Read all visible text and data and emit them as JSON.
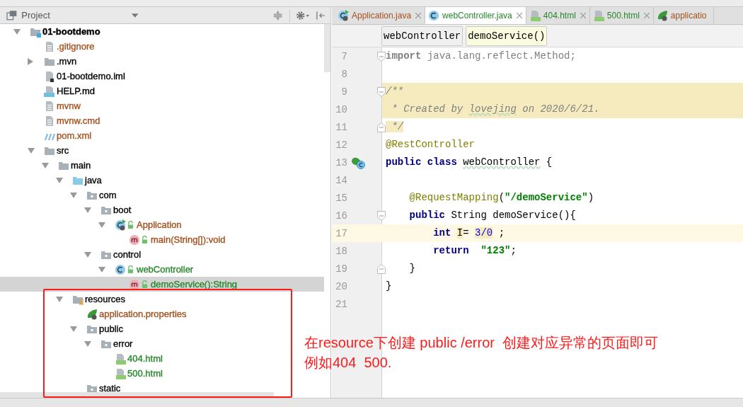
{
  "project_panel": {
    "title": "Project",
    "tree": [
      {
        "label": "01-bootdemo",
        "kind": "module",
        "color": "#000000",
        "expanded": true,
        "selected": false,
        "children": [
          {
            "label": ".gitignore",
            "kind": "file",
            "color": "#a4501e",
            "selected": false
          },
          {
            "label": ".mvn",
            "kind": "folder",
            "color": "#000000",
            "expanded": false,
            "selected": false
          },
          {
            "label": "01-bootdemo.iml",
            "kind": "iml",
            "color": "#000000",
            "selected": false
          },
          {
            "label": "HELP.md",
            "kind": "md",
            "color": "#000000",
            "selected": false
          },
          {
            "label": "mvnw",
            "kind": "file",
            "color": "#a4501e",
            "selected": false
          },
          {
            "label": "mvnw.cmd",
            "kind": "file",
            "color": "#a4501e",
            "selected": false
          },
          {
            "label": "pom.xml",
            "kind": "maven",
            "color": "#a4501e",
            "selected": false
          },
          {
            "label": "src",
            "kind": "folder",
            "color": "#000000",
            "expanded": true,
            "selected": false,
            "children": [
              {
                "label": "main",
                "kind": "folder",
                "color": "#000000",
                "expanded": true,
                "selected": false,
                "children": [
                  {
                    "label": "java",
                    "kind": "source",
                    "color": "#000000",
                    "expanded": true,
                    "selected": false,
                    "children": [
                      {
                        "label": "com",
                        "kind": "package",
                        "color": "#000000",
                        "expanded": true,
                        "selected": false,
                        "children": [
                          {
                            "label": "boot",
                            "kind": "package",
                            "color": "#000000",
                            "expanded": true,
                            "selected": false,
                            "children": [
                              {
                                "label": "Application",
                                "kind": "spring-class",
                                "color": "#a4501e",
                                "expanded": true,
                                "selected": false,
                                "children": [
                                  {
                                    "label": "main(String[]):void",
                                    "kind": "method",
                                    "color": "#a4501e",
                                    "selected": false
                                  }
                                ]
                              }
                            ]
                          },
                          {
                            "label": "control",
                            "kind": "package",
                            "color": "#000000",
                            "expanded": true,
                            "selected": false,
                            "children": [
                              {
                                "label": "webController",
                                "kind": "class",
                                "color": "#26882a",
                                "expanded": true,
                                "selected": false,
                                "children": [
                                  {
                                    "label": "demoService():String",
                                    "kind": "method",
                                    "color": "#26882a",
                                    "selected": true
                                  }
                                ]
                              }
                            ]
                          }
                        ]
                      }
                    ]
                  },
                  {
                    "label": "resources",
                    "kind": "resources",
                    "color": "#000000",
                    "expanded": true,
                    "selected": false,
                    "children": [
                      {
                        "label": "application.properties",
                        "kind": "spring-config",
                        "color": "#a4501e",
                        "selected": false
                      },
                      {
                        "label": "public",
                        "kind": "package",
                        "color": "#000000",
                        "expanded": true,
                        "selected": false,
                        "children": [
                          {
                            "label": "error",
                            "kind": "package",
                            "color": "#000000",
                            "expanded": true,
                            "selected": false,
                            "children": [
                              {
                                "label": "404.html",
                                "kind": "html",
                                "color": "#26882a",
                                "selected": false
                              },
                              {
                                "label": "500.html",
                                "kind": "html",
                                "color": "#26882a",
                                "selected": false
                              }
                            ]
                          }
                        ]
                      },
                      {
                        "label": "static",
                        "kind": "package",
                        "color": "#000000",
                        "selected": false
                      }
                    ]
                  }
                ]
              }
            ]
          }
        ]
      }
    ]
  },
  "editor": {
    "tabs": [
      {
        "label": "Application.java",
        "kind": "spring-class",
        "color": "#a4501e",
        "selected": false,
        "closable": true
      },
      {
        "label": "webController.java",
        "kind": "class",
        "color": "#26882a",
        "selected": true,
        "closable": true
      },
      {
        "label": "404.html",
        "kind": "html",
        "color": "#26882a",
        "selected": false,
        "closable": true
      },
      {
        "label": "500.html",
        "kind": "html",
        "color": "#26882a",
        "selected": false,
        "closable": true
      },
      {
        "label": "applicatio",
        "kind": "spring-config",
        "color": "#a4501e",
        "selected": false,
        "closable": false
      }
    ],
    "breadcrumbs": [
      {
        "label": "webController",
        "selected": false
      },
      {
        "label": "demoService()",
        "selected": true
      }
    ],
    "lines": [
      {
        "number": "7",
        "fold_start": true,
        "tokens": [
          {
            "text": "import",
            "kind": "unused-keyword"
          },
          {
            "text": " java.lang.reflect.Method;",
            "kind": "unused"
          }
        ]
      },
      {
        "number": "8"
      },
      {
        "number": "9",
        "fold_start": true,
        "highlight": true,
        "tokens": [
          {
            "text": "/**",
            "kind": "doc"
          }
        ]
      },
      {
        "number": "10",
        "highlight": true,
        "tokens": [
          {
            "text": " * Created by ",
            "kind": "doc"
          },
          {
            "text": "lovejing",
            "kind": "doc-typo"
          },
          {
            "text": " on 2020/6/21.",
            "kind": "doc"
          }
        ]
      },
      {
        "number": "11",
        "fold_end": true,
        "tokens": [
          {
            "text": " */",
            "kind": "doc",
            "marked": true
          }
        ]
      },
      {
        "number": "12",
        "tokens": [
          {
            "text": "@RestController",
            "kind": "annotation"
          }
        ]
      },
      {
        "number": "13",
        "bean_marker": true,
        "tokens": [
          {
            "text": "public class ",
            "kind": "keyword"
          },
          {
            "text": "webController",
            "kind": "typo"
          },
          {
            "text": " {",
            "kind": "plain"
          }
        ]
      },
      {
        "number": "14"
      },
      {
        "number": "15",
        "tokens": [
          {
            "text": "    @RequestMapping",
            "kind": "annotation"
          },
          {
            "text": "(",
            "kind": "plain"
          },
          {
            "text": "\"/demoService\"",
            "kind": "string"
          },
          {
            "text": ")",
            "kind": "plain"
          }
        ]
      },
      {
        "number": "16",
        "fold_start": true,
        "tokens": [
          {
            "text": "    public",
            "kind": "keyword"
          },
          {
            "text": " String demoService(){",
            "kind": "plain"
          }
        ]
      },
      {
        "number": "17",
        "current": true,
        "tokens": [
          {
            "text": "        int ",
            "kind": "keyword"
          },
          {
            "text": "I",
            "kind": "plain",
            "marked": true
          },
          {
            "text": "= ",
            "kind": "plain"
          },
          {
            "text": "3/0",
            "kind": "number",
            "marked": true
          },
          {
            "text": " ;",
            "kind": "plain"
          }
        ]
      },
      {
        "number": "18",
        "tokens": [
          {
            "text": "        return  ",
            "kind": "keyword"
          },
          {
            "text": "\"123\"",
            "kind": "string"
          },
          {
            "text": ";",
            "kind": "plain"
          }
        ]
      },
      {
        "number": "19",
        "fold_end": true,
        "tokens": [
          {
            "text": "    }",
            "kind": "plain"
          }
        ]
      },
      {
        "number": "20",
        "tokens": [
          {
            "text": "}",
            "kind": "plain"
          }
        ]
      },
      {
        "number": "21"
      }
    ]
  },
  "annotation": {
    "lines": [
      "在resource下创建 public /error  创建对应异常的页面即可",
      "例如404  500."
    ]
  }
}
